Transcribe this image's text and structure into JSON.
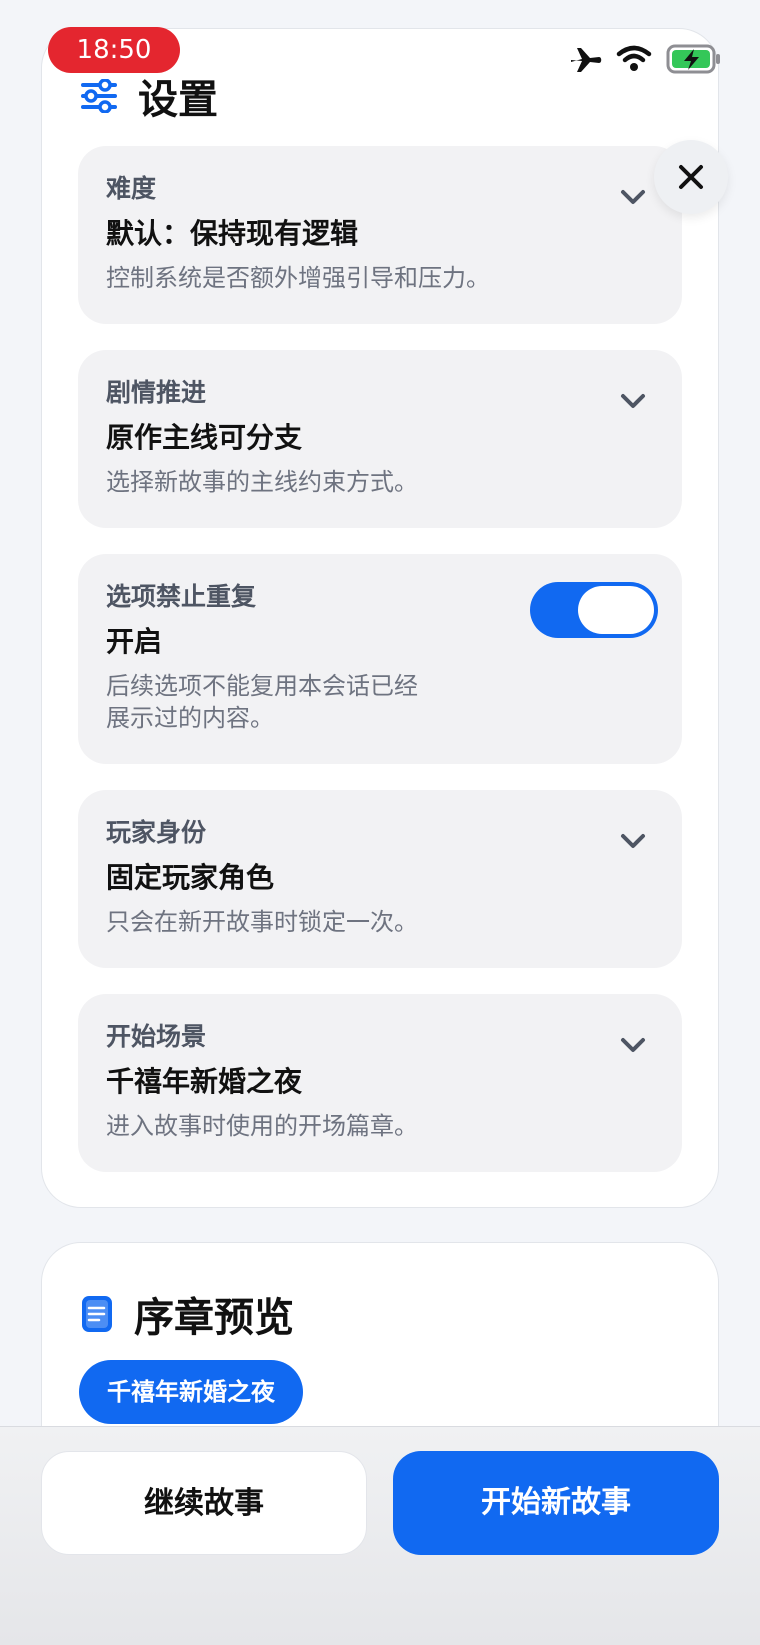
{
  "status_bar": {
    "time": "18:50"
  },
  "settings": {
    "title": "设置",
    "options": [
      {
        "label": "难度",
        "value": "默认：保持现有逻辑",
        "description": "控制系统是否额外增强引导和压力。",
        "control": "dropdown"
      },
      {
        "label": "剧情推进",
        "value": "原作主线可分支",
        "description": "选择新故事的主线约束方式。",
        "control": "dropdown"
      },
      {
        "label": "选项禁止重复",
        "value": "开启",
        "description_lines": [
          "后续选项不能复用本会话已经",
          "展示过的内容。"
        ],
        "control": "toggle",
        "toggle_on": true
      },
      {
        "label": "玩家身份",
        "value": "固定玩家角色",
        "description": "只会在新开故事时锁定一次。",
        "control": "dropdown"
      },
      {
        "label": "开始场景",
        "value": "千禧年新婚之夜",
        "description": "进入故事时使用的开场篇章。",
        "control": "dropdown"
      }
    ]
  },
  "preview": {
    "title": "序章预览",
    "chip": "千禧年新婚之夜"
  },
  "actions": {
    "continue_label": "继续故事",
    "new_label": "开始新故事"
  },
  "colors": {
    "accent": "#1169f1",
    "time_pill": "#e4262f",
    "battery": "#34c759"
  },
  "icons": [
    "sliders-icon",
    "close-icon",
    "chevron-down-icon",
    "document-icon",
    "airplane-icon",
    "wifi-icon",
    "battery-charging-icon"
  ]
}
